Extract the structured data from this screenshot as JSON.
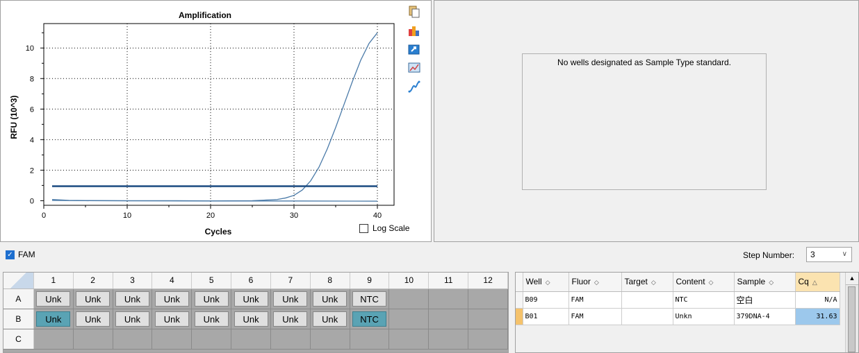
{
  "chart": {
    "title": "Amplification",
    "xlabel": "Cycles",
    "ylabel": "RFU (10^3)",
    "x_ticks": [
      "0",
      "10",
      "20",
      "30",
      "40"
    ],
    "y_ticks": [
      "0",
      "2",
      "4",
      "6",
      "8",
      "10"
    ],
    "log_scale_label": "Log Scale",
    "log_scale_checked": false
  },
  "chart_data": {
    "type": "line",
    "title": "Amplification",
    "xlabel": "Cycles",
    "ylabel": "RFU (10^3)",
    "xlim": [
      0,
      42
    ],
    "ylim": [
      -0.3,
      11.6
    ],
    "grid": true,
    "threshold": 0.95,
    "series": [
      {
        "color": "#4a7aa8",
        "x": [
          1,
          2,
          3,
          5,
          10,
          15,
          20,
          25,
          28,
          29,
          30,
          31,
          32,
          33,
          34,
          35,
          36,
          37,
          38,
          39,
          40
        ],
        "y": [
          0.08,
          0.05,
          0.02,
          0.01,
          0.0,
          0.0,
          -0.01,
          0.0,
          0.08,
          0.18,
          0.35,
          0.7,
          1.3,
          2.2,
          3.4,
          4.8,
          6.3,
          7.8,
          9.2,
          10.3,
          11.0
        ]
      },
      {
        "color": "#4a7aa8",
        "x": [
          1,
          5,
          10,
          20,
          30,
          40
        ],
        "y": [
          0.02,
          0.0,
          -0.01,
          -0.02,
          -0.02,
          -0.03
        ]
      }
    ]
  },
  "toolbar_icons": [
    "copy-icon",
    "color-palette-icon",
    "export-icon",
    "chart-settings-icon",
    "curve-icon"
  ],
  "standard_panel": {
    "message": "No wells designated as Sample Type standard."
  },
  "fluor": {
    "label": "FAM",
    "checked": true
  },
  "step": {
    "label": "Step Number:",
    "value": "3"
  },
  "plate": {
    "columns": [
      "1",
      "2",
      "3",
      "4",
      "5",
      "6",
      "7",
      "8",
      "9",
      "10",
      "11",
      "12"
    ],
    "rows": [
      {
        "label": "A",
        "wells": [
          "Unk",
          "Unk",
          "Unk",
          "Unk",
          "Unk",
          "Unk",
          "Unk",
          "Unk",
          "NTC",
          "",
          "",
          ""
        ]
      },
      {
        "label": "B",
        "wells": [
          "Unk",
          "Unk",
          "Unk",
          "Unk",
          "Unk",
          "Unk",
          "Unk",
          "Unk",
          "NTC",
          "",
          "",
          ""
        ]
      },
      {
        "label": "C",
        "wells": [
          "",
          "",
          "",
          "",
          "",
          "",
          "",
          "",
          "",
          "",
          "",
          ""
        ]
      }
    ]
  },
  "well_table": {
    "headers": [
      "Well",
      "Fluor",
      "Target",
      "Content",
      "Sample",
      "Cq"
    ],
    "rows": [
      {
        "well": "B09",
        "fluor": "FAM",
        "target": "",
        "content": "NTC",
        "sample": "空白",
        "cq": "N/A"
      },
      {
        "well": "B01",
        "fluor": "FAM",
        "target": "",
        "content": "Unkn",
        "sample": "379DNA-4",
        "cq": "31.63"
      }
    ]
  }
}
